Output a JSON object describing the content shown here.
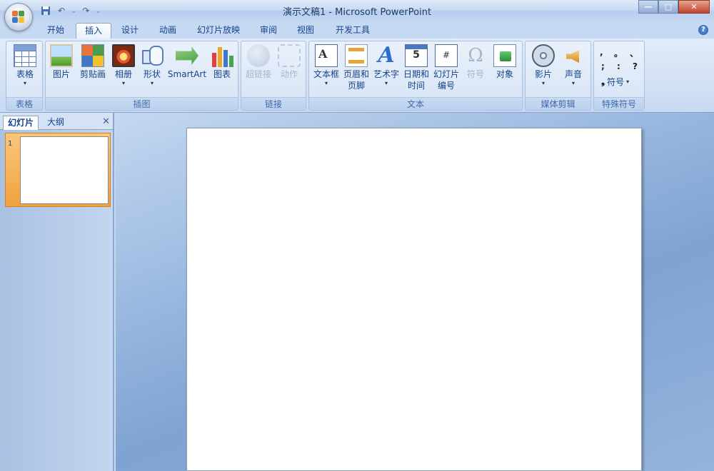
{
  "window": {
    "title": "演示文稿1 - Microsoft PowerPoint",
    "controls": {
      "minimize": "—",
      "maximize": "□",
      "close": "✕"
    }
  },
  "quick_access": {
    "dropdown": "⌄"
  },
  "tabs": [
    "开始",
    "插入",
    "设计",
    "动画",
    "幻灯片放映",
    "审阅",
    "视图",
    "开发工具"
  ],
  "active_tab": "插入",
  "help": "?",
  "ribbon": {
    "groups": {
      "table": {
        "label": "表格",
        "buttons": {
          "table": "表格"
        }
      },
      "illustrations": {
        "label": "插图",
        "buttons": {
          "picture": "图片",
          "clipart": "剪贴画",
          "album": "相册",
          "shapes": "形状",
          "smartart": "SmartArt",
          "chart": "图表"
        }
      },
      "links": {
        "label": "链接",
        "buttons": {
          "hyperlink": "超链接",
          "action": "动作"
        }
      },
      "text": {
        "label": "文本",
        "buttons": {
          "textbox": "文本框",
          "header_line1": "页眉和",
          "header_line2": "页脚",
          "wordart": "艺术字",
          "date_line1": "日期和",
          "date_line2": "时间",
          "slidenum_line1": "幻灯片",
          "slidenum_line2": "编号",
          "symbol": "符号",
          "object": "对象"
        },
        "icons": {
          "textbox_glyph": "A",
          "wordart_glyph": "A",
          "date_glyph": "5",
          "slidenum_glyph": "#",
          "symbol_glyph": "Ω"
        }
      },
      "media": {
        "label": "媒体剪辑",
        "buttons": {
          "movie": "影片",
          "sound": "声音"
        }
      },
      "special": {
        "label": "特殊符号",
        "symbols": [
          ",",
          "。",
          "、",
          ";",
          ":",
          "?"
        ],
        "symbol_button": "符号",
        "symbol_glyph": "❟"
      }
    }
  },
  "pane": {
    "tabs": {
      "slides": "幻灯片",
      "outline": "大纲"
    },
    "close": "✕",
    "slide_number": "1"
  },
  "colors": {
    "ribbon_text": "#15428b",
    "selected_thumb": "#f2a13e",
    "workspace": "#9ab8e0"
  }
}
